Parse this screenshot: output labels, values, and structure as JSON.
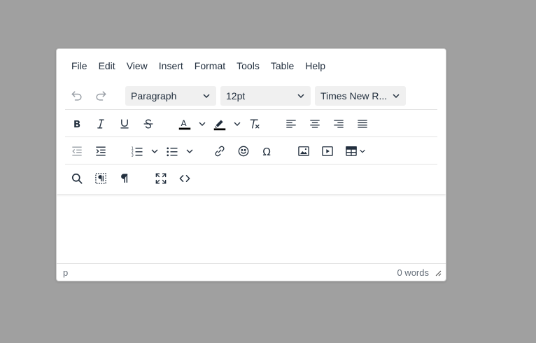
{
  "menubar": {
    "items": [
      "File",
      "Edit",
      "View",
      "Insert",
      "Format",
      "Tools",
      "Table",
      "Help"
    ]
  },
  "toolbar": {
    "block_format": "Paragraph",
    "font_size": "12pt",
    "font_family": "Times New R..."
  },
  "statusbar": {
    "path": "p",
    "word_count": "0 words"
  },
  "colors": {
    "text_color_bar": "#000000",
    "highlight_color_bar": "#000000",
    "icon": "#222f3e",
    "background": "#a0a0a0"
  }
}
